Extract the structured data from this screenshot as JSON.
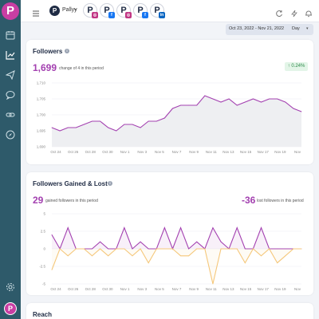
{
  "sidebar": {
    "logo_letter": "P",
    "avatar_letter": "P",
    "items": [
      {
        "name": "calendar"
      },
      {
        "name": "analytics"
      },
      {
        "name": "publish"
      },
      {
        "name": "messages"
      },
      {
        "name": "links"
      },
      {
        "name": "discover"
      }
    ]
  },
  "topbar": {
    "brand_initial": "P",
    "brand_name": "Pallyy",
    "profiles": [
      {
        "letter": "P",
        "network": "instagram",
        "color": "#c13584",
        "glyph": "◎"
      },
      {
        "letter": "P",
        "network": "facebook",
        "color": "#1877f2",
        "glyph": "f"
      },
      {
        "letter": "P",
        "network": "instagram",
        "color": "#c13584",
        "glyph": "◎"
      },
      {
        "letter": "P",
        "network": "facebook",
        "color": "#1877f2",
        "glyph": "f"
      },
      {
        "letter": "P",
        "network": "linkedin",
        "color": "#0a66c2",
        "glyph": "in"
      }
    ]
  },
  "datebar": {
    "range": "Oct 23, 2022 - Nov 21, 2022",
    "granularity": "Day"
  },
  "followers": {
    "title": "Followers",
    "total": "1,699",
    "change_text": "change of 4 in this period",
    "pct": "↑ 0.24%"
  },
  "gained_lost": {
    "title": "Followers Gained & Lost",
    "gained": "29",
    "gained_text": "gained followers in this period",
    "lost": "-36",
    "lost_text": "lost followers in this period"
  },
  "reach": {
    "title": "Reach"
  },
  "chart_data": [
    {
      "type": "area",
      "title": "Followers",
      "x": [
        "Oct 24",
        "Oct 26",
        "Oct 28",
        "Oct 30",
        "Nov 1",
        "Nov 3",
        "Nov 5",
        "Nov 7",
        "Nov 9",
        "Nov 11",
        "Nov 13",
        "Nov 15",
        "Nov 17",
        "Nov 19",
        "Nov"
      ],
      "ytick_labels": [
        "1,710",
        "1,705",
        "1,700",
        "1,695",
        "1,690"
      ],
      "ylim": [
        1690,
        1710
      ],
      "values": [
        1696,
        1695,
        1696,
        1696,
        1697,
        1698,
        1698,
        1696,
        1695,
        1697,
        1697,
        1696,
        1698,
        1698,
        1699,
        1702,
        1703,
        1703,
        1703,
        1706,
        1705,
        1704,
        1705,
        1703,
        1704,
        1705,
        1704,
        1705,
        1705,
        1704,
        1702,
        1701
      ],
      "series_color": "#a340b0"
    },
    {
      "type": "line",
      "title": "Followers Gained & Lost",
      "x": [
        "Oct 24",
        "Oct 26",
        "Oct 28",
        "Oct 30",
        "Nov 1",
        "Nov 3",
        "Nov 5",
        "Nov 7",
        "Nov 9",
        "Nov 11",
        "Nov 13",
        "Nov 15",
        "Nov 17",
        "Nov 19",
        "Nov"
      ],
      "ytick_labels": [
        "5",
        "2.5",
        "0",
        "-2.5",
        "-5"
      ],
      "ylim": [
        -5,
        5
      ],
      "series": [
        {
          "color": "#a340b0",
          "values": [
            2,
            0,
            3,
            0,
            0,
            0,
            1,
            0,
            0,
            3,
            0,
            1,
            0,
            0,
            3,
            0,
            3,
            0,
            1,
            0,
            3,
            1,
            0,
            3,
            0,
            0,
            3,
            0,
            0,
            0,
            0,
            0
          ]
        },
        {
          "color": "#f5c77a",
          "values": [
            -3,
            0,
            -1,
            0,
            0,
            -1,
            0,
            -1,
            0,
            0,
            -1,
            0,
            -2,
            0,
            0,
            0,
            -1,
            -1,
            0,
            0,
            -5,
            0,
            0,
            0,
            -2,
            0,
            -1,
            0,
            -2,
            -1,
            0,
            0
          ]
        }
      ]
    }
  ]
}
